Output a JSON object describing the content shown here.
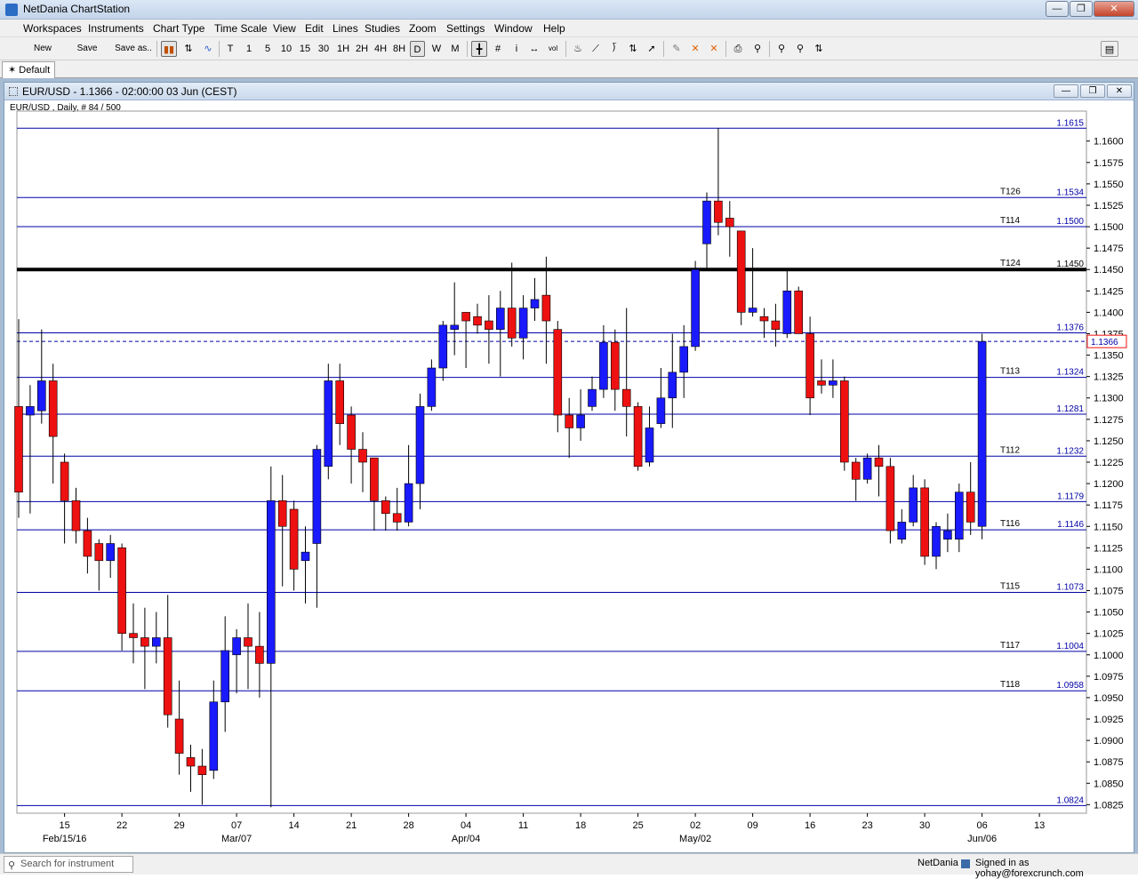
{
  "window": {
    "title": "NetDania ChartStation"
  },
  "menu": [
    "Workspaces",
    "Instruments",
    "Chart Type",
    "Time Scale",
    "View",
    "Edit",
    "Lines",
    "Studies",
    "Zoom",
    "Settings",
    "Window",
    "Help"
  ],
  "toolbar": {
    "new_label": "New",
    "save_label": "Save",
    "save_as_label": "Save as..",
    "timescales": [
      "T",
      "1",
      "5",
      "10",
      "15",
      "30",
      "1H",
      "2H",
      "4H",
      "8H",
      "D",
      "W",
      "M"
    ],
    "selected_timescale": "D"
  },
  "tab": {
    "label": "Default"
  },
  "chart_window": {
    "title": "EUR/USD - 1.1366 - 02:00:00  03 Jun (CEST)",
    "subtitle": "EUR/USD , Daily, # 84 / 500"
  },
  "status": {
    "search_placeholder": "Search for instrument",
    "provider": "NetDania",
    "signed_in": "Signed in as yohay@forexcrunch.com"
  },
  "colors": {
    "up": "#1a1aff",
    "down": "#ee1111",
    "hline": "#0000a8",
    "bold_line": "#000000"
  },
  "chart_data": {
    "type": "candlestick",
    "instrument": "EUR/USD",
    "interval": "Daily",
    "ylim": [
      1.0815,
      1.1635
    ],
    "y_ticks": [
      "1.1600",
      "1.1575",
      "1.1550",
      "1.1525",
      "1.1500",
      "1.1475",
      "1.1450",
      "1.1425",
      "1.1400",
      "1.1375",
      "1.1350",
      "1.1325",
      "1.1300",
      "1.1275",
      "1.1250",
      "1.1225",
      "1.1200",
      "1.1175",
      "1.1150",
      "1.1125",
      "1.1100",
      "1.1075",
      "1.1050",
      "1.1025",
      "1.1000",
      "1.0975",
      "1.0950",
      "1.0925",
      "1.0900",
      "1.0875",
      "1.0850",
      "1.0825"
    ],
    "x_ticks": [
      {
        "i": 4,
        "label": "15",
        "sub": "Feb/15/16"
      },
      {
        "i": 9,
        "label": "22",
        "sub": ""
      },
      {
        "i": 14,
        "label": "29",
        "sub": ""
      },
      {
        "i": 19,
        "label": "07",
        "sub": "Mar/07"
      },
      {
        "i": 24,
        "label": "14",
        "sub": ""
      },
      {
        "i": 29,
        "label": "21",
        "sub": ""
      },
      {
        "i": 34,
        "label": "28",
        "sub": ""
      },
      {
        "i": 39,
        "label": "04",
        "sub": "Apr/04"
      },
      {
        "i": 44,
        "label": "11",
        "sub": ""
      },
      {
        "i": 49,
        "label": "18",
        "sub": ""
      },
      {
        "i": 54,
        "label": "25",
        "sub": ""
      },
      {
        "i": 59,
        "label": "02",
        "sub": "May/02"
      },
      {
        "i": 64,
        "label": "09",
        "sub": ""
      },
      {
        "i": 69,
        "label": "16",
        "sub": ""
      },
      {
        "i": 74,
        "label": "23",
        "sub": ""
      },
      {
        "i": 79,
        "label": "30",
        "sub": ""
      },
      {
        "i": 84,
        "label": "06",
        "sub": "Jun/06"
      },
      {
        "i": 89,
        "label": "13",
        "sub": ""
      }
    ],
    "candles": [
      [
        1.129,
        1.1392,
        1.116,
        1.119
      ],
      [
        1.128,
        1.1315,
        1.1165,
        1.129
      ],
      [
        1.1285,
        1.138,
        1.127,
        1.132
      ],
      [
        1.132,
        1.134,
        1.12,
        1.1255
      ],
      [
        1.1225,
        1.1235,
        1.113,
        1.118
      ],
      [
        1.118,
        1.1195,
        1.113,
        1.1145
      ],
      [
        1.1145,
        1.116,
        1.1095,
        1.1115
      ],
      [
        1.113,
        1.1135,
        1.1075,
        1.111
      ],
      [
        1.111,
        1.114,
        1.109,
        1.113
      ],
      [
        1.1125,
        1.113,
        1.1005,
        1.1025
      ],
      [
        1.1025,
        1.106,
        1.099,
        1.102
      ],
      [
        1.102,
        1.1055,
        1.096,
        1.101
      ],
      [
        1.101,
        1.105,
        1.099,
        1.102
      ],
      [
        1.102,
        1.107,
        1.0915,
        1.093
      ],
      [
        1.0925,
        1.097,
        1.086,
        1.0885
      ],
      [
        1.088,
        1.0895,
        1.084,
        1.087
      ],
      [
        1.087,
        1.089,
        1.0825,
        1.086
      ],
      [
        1.0865,
        1.097,
        1.0855,
        1.0945
      ],
      [
        1.0945,
        1.1045,
        1.091,
        1.1005
      ],
      [
        1.1,
        1.103,
        1.0955,
        1.102
      ],
      [
        1.102,
        1.106,
        1.096,
        1.101
      ],
      [
        1.101,
        1.105,
        1.095,
        1.099
      ],
      [
        1.099,
        1.122,
        1.0822,
        1.118
      ],
      [
        1.118,
        1.121,
        1.108,
        1.115
      ],
      [
        1.117,
        1.118,
        1.1075,
        1.11
      ],
      [
        1.111,
        1.115,
        1.106,
        1.112
      ],
      [
        1.113,
        1.1245,
        1.1055,
        1.124
      ],
      [
        1.122,
        1.134,
        1.1205,
        1.132
      ],
      [
        1.132,
        1.134,
        1.1245,
        1.127
      ],
      [
        1.128,
        1.129,
        1.12,
        1.124
      ],
      [
        1.124,
        1.126,
        1.119,
        1.1225
      ],
      [
        1.123,
        1.123,
        1.1145,
        1.118
      ],
      [
        1.118,
        1.1185,
        1.1145,
        1.1165
      ],
      [
        1.1165,
        1.1195,
        1.1145,
        1.1155
      ],
      [
        1.1155,
        1.1245,
        1.115,
        1.12
      ],
      [
        1.12,
        1.1305,
        1.117,
        1.129
      ],
      [
        1.129,
        1.1345,
        1.1285,
        1.1335
      ],
      [
        1.1335,
        1.139,
        1.132,
        1.1385
      ],
      [
        1.138,
        1.1435,
        1.135,
        1.1385
      ],
      [
        1.14,
        1.139,
        1.1335,
        1.139
      ],
      [
        1.1395,
        1.141,
        1.1375,
        1.1385
      ],
      [
        1.139,
        1.142,
        1.134,
        1.138
      ],
      [
        1.138,
        1.1425,
        1.1325,
        1.1405
      ],
      [
        1.1405,
        1.1458,
        1.136,
        1.137
      ],
      [
        1.137,
        1.142,
        1.1345,
        1.1405
      ],
      [
        1.1405,
        1.144,
        1.139,
        1.1415
      ],
      [
        1.142,
        1.1465,
        1.134,
        1.139
      ],
      [
        1.138,
        1.139,
        1.126,
        1.128
      ],
      [
        1.128,
        1.13,
        1.123,
        1.1265
      ],
      [
        1.1265,
        1.131,
        1.125,
        1.128
      ],
      [
        1.129,
        1.1325,
        1.1285,
        1.131
      ],
      [
        1.131,
        1.1385,
        1.13,
        1.1365
      ],
      [
        1.1365,
        1.138,
        1.1285,
        1.131
      ],
      [
        1.131,
        1.1405,
        1.1255,
        1.129
      ],
      [
        1.129,
        1.1295,
        1.1215,
        1.122
      ],
      [
        1.1225,
        1.129,
        1.122,
        1.1265
      ],
      [
        1.127,
        1.1335,
        1.1265,
        1.13
      ],
      [
        1.13,
        1.1375,
        1.1265,
        1.133
      ],
      [
        1.133,
        1.1385,
        1.13,
        1.136
      ],
      [
        1.136,
        1.146,
        1.1355,
        1.145
      ],
      [
        1.148,
        1.154,
        1.145,
        1.153
      ],
      [
        1.153,
        1.1615,
        1.149,
        1.1505
      ],
      [
        1.151,
        1.153,
        1.1465,
        1.15
      ],
      [
        1.1495,
        1.1495,
        1.1385,
        1.14
      ],
      [
        1.14,
        1.1475,
        1.1395,
        1.1405
      ],
      [
        1.1395,
        1.1405,
        1.137,
        1.139
      ],
      [
        1.139,
        1.141,
        1.136,
        1.138
      ],
      [
        1.1375,
        1.145,
        1.137,
        1.1425
      ],
      [
        1.1425,
        1.143,
        1.1375,
        1.1375
      ],
      [
        1.1375,
        1.1395,
        1.128,
        1.13
      ],
      [
        1.132,
        1.1345,
        1.1305,
        1.1315
      ],
      [
        1.1315,
        1.1345,
        1.13,
        1.132
      ],
      [
        1.132,
        1.1325,
        1.1215,
        1.1225
      ],
      [
        1.1225,
        1.123,
        1.118,
        1.1205
      ],
      [
        1.1205,
        1.1235,
        1.12,
        1.123
      ],
      [
        1.123,
        1.1245,
        1.1185,
        1.122
      ],
      [
        1.122,
        1.123,
        1.113,
        1.1145
      ],
      [
        1.1135,
        1.117,
        1.113,
        1.1155
      ],
      [
        1.1155,
        1.121,
        1.115,
        1.1195
      ],
      [
        1.1195,
        1.1205,
        1.1105,
        1.1115
      ],
      [
        1.1115,
        1.1155,
        1.11,
        1.115
      ],
      [
        1.1135,
        1.1165,
        1.112,
        1.1145
      ],
      [
        1.1135,
        1.12,
        1.112,
        1.119
      ],
      [
        1.119,
        1.1225,
        1.114,
        1.1155
      ],
      [
        1.115,
        1.1375,
        1.1135,
        1.1366
      ]
    ],
    "horizontal_lines": [
      {
        "label": "",
        "value": 1.1615,
        "value_text": "1.1615",
        "bold": false
      },
      {
        "label": "T126",
        "value": 1.1534,
        "value_text": "1.1534",
        "bold": false
      },
      {
        "label": "T114",
        "value": 1.15,
        "value_text": "1.1500",
        "bold": false
      },
      {
        "label": "T124",
        "value": 1.145,
        "value_text": "1.1450",
        "bold": true
      },
      {
        "label": "",
        "value": 1.1376,
        "value_text": "1.1376",
        "bold": false
      },
      {
        "label": "T113",
        "value": 1.1324,
        "value_text": "1.1324",
        "bold": false
      },
      {
        "label": "",
        "value": 1.1281,
        "value_text": "1.1281",
        "bold": false
      },
      {
        "label": "T112",
        "value": 1.1232,
        "value_text": "1.1232",
        "bold": false
      },
      {
        "label": "",
        "value": 1.1179,
        "value_text": "1.1179",
        "bold": false
      },
      {
        "label": "T116",
        "value": 1.1146,
        "value_text": "1.1146",
        "bold": false
      },
      {
        "label": "T115",
        "value": 1.1073,
        "value_text": "1.1073",
        "bold": false
      },
      {
        "label": "T117",
        "value": 1.1004,
        "value_text": "1.1004",
        "bold": false
      },
      {
        "label": "T118",
        "value": 1.0958,
        "value_text": "1.0958",
        "bold": false
      },
      {
        "label": "",
        "value": 1.0824,
        "value_text": "1.0824",
        "bold": false
      }
    ],
    "current_price": 1.1366,
    "current_price_text": "1.1366"
  }
}
